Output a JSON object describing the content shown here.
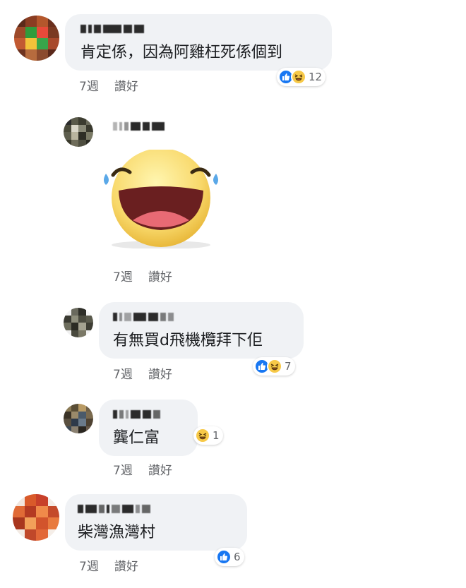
{
  "colors": {
    "bubble": "#f0f2f5",
    "meta_text": "#65676b",
    "like_blue": "#1877f2",
    "haha_yellow": "#f7c948"
  },
  "comments": [
    {
      "text": "肯定係，因為阿雞枉死係個到",
      "time": "7週",
      "like_label": "讚好",
      "reactions": [
        "like-icon",
        "haha-icon"
      ],
      "reaction_count": "12"
    },
    {
      "sticker": "haha-sticker",
      "time": "7週",
      "like_label": "讚好"
    },
    {
      "text": "有無買d飛機欖拜下佢",
      "time": "7週",
      "like_label": "讚好",
      "reactions": [
        "like-icon",
        "haha-icon"
      ],
      "reaction_count": "7"
    },
    {
      "text": "龔仁富",
      "time": "7週",
      "like_label": "讚好",
      "reactions": [
        "haha-icon"
      ],
      "reaction_count": "1"
    },
    {
      "text": "柴灣漁灣村",
      "time": "7週",
      "like_label": "讚好",
      "reactions": [
        "like-icon"
      ],
      "reaction_count": "6"
    }
  ]
}
